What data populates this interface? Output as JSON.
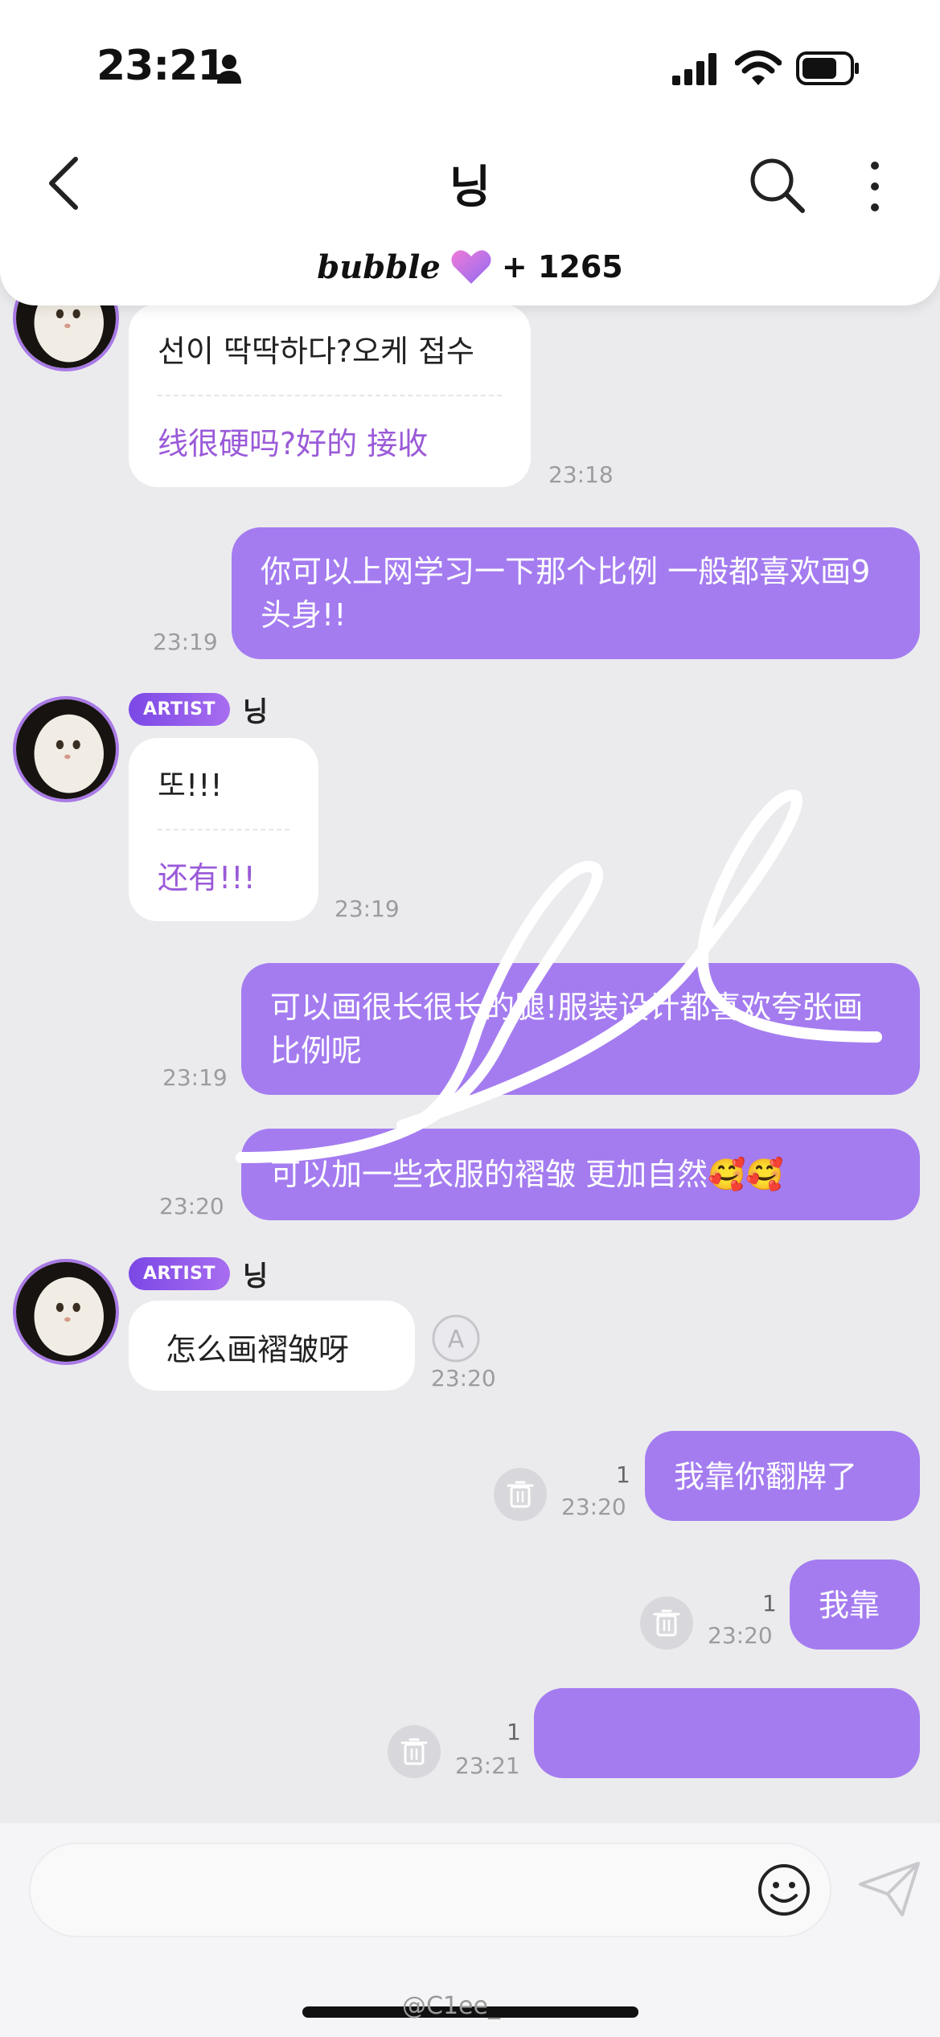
{
  "status_bar": {
    "time": "23:21"
  },
  "header": {
    "title": "닝",
    "brand": "bubble",
    "subscriber_count": "+ 1265"
  },
  "messages": {
    "m1": {
      "ko": "선이 딱딱하다?오케 접수",
      "zh": "线很硬吗?好的 接收",
      "time": "23:18"
    },
    "m2": {
      "text": "你可以上网学习一下那个比例 一般都喜欢画9头身!!",
      "time": "23:19"
    },
    "m3": {
      "badge": "ARTIST",
      "name": "닝",
      "ko": "또!!!",
      "zh": "还有!!!",
      "time": "23:19"
    },
    "m4": {
      "text": "可以画很长很长的腿!服装设计都喜欢夸张画比例呢",
      "time": "23:19"
    },
    "m5": {
      "text": "可以加一些衣服的褶皱 更加自然🥰🥰",
      "time": "23:20"
    },
    "m6": {
      "badge": "ARTIST",
      "name": "닝",
      "text": "怎么画褶皱呀",
      "time": "23:20"
    },
    "m7": {
      "text": "我靠你翻牌了",
      "unread": "1",
      "time": "23:20"
    },
    "m8": {
      "text": "我靠",
      "unread": "1",
      "time": "23:20"
    },
    "m9": {
      "text": "",
      "unread": "1",
      "time": "23:21"
    }
  },
  "input": {
    "placeholder": ""
  },
  "watermark": "@C1ee_",
  "colors": {
    "accent": "#a47cf0",
    "artist_badge": "#7b48e6",
    "translation": "#9a5ad8"
  },
  "icons": [
    "person-icon",
    "signal-icon",
    "wifi-icon",
    "battery-icon",
    "back-icon",
    "search-icon",
    "more-icon",
    "heart-icon",
    "emoji-icon",
    "send-icon",
    "trash-icon",
    "translate-icon"
  ]
}
